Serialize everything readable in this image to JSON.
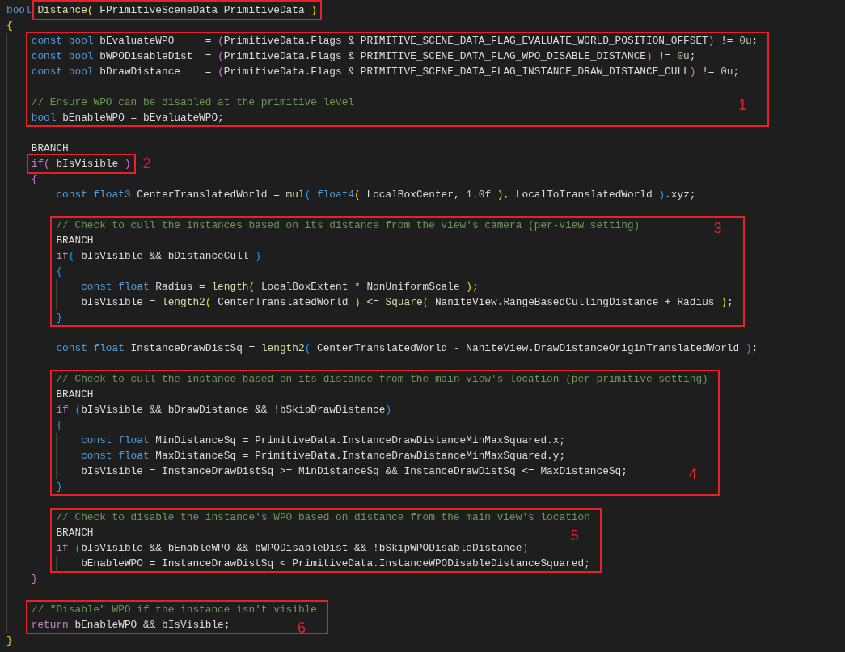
{
  "editor": {
    "items": [
      {
        "kind": "line",
        "tokens": [
          {
            "kind": "keyword",
            "text": "bool "
          },
          {
            "kind": "boxed",
            "tokens": [
              {
                "kind": "function",
                "text": "Distance"
              },
              {
                "kind": "bracket1",
                "text": "("
              },
              {
                "kind": "plain",
                "text": " FPrimitiveSceneData PrimitiveData "
              },
              {
                "kind": "bracket1",
                "text": ")"
              }
            ]
          }
        ]
      },
      {
        "kind": "line",
        "tokens": [
          {
            "kind": "bracket1",
            "text": "{"
          }
        ]
      },
      {
        "kind": "block",
        "children": [
          {
            "kind": "box",
            "children": [
              {
                "kind": "line",
                "tokens": [
                  {
                    "kind": "keyword",
                    "text": "const bool "
                  },
                  {
                    "kind": "plain",
                    "text": "bEvaluateWPO     = "
                  },
                  {
                    "kind": "bracket2",
                    "text": "("
                  },
                  {
                    "kind": "plain",
                    "text": "PrimitiveData.Flags & PRIMITIVE_SCENE_DATA_FLAG_EVALUATE_WORLD_POSITION_OFFSET"
                  },
                  {
                    "kind": "bracket2",
                    "text": ")"
                  },
                  {
                    "kind": "plain",
                    "text": " != "
                  },
                  {
                    "kind": "number",
                    "text": "0u"
                  },
                  {
                    "kind": "plain",
                    "text": ";"
                  }
                ]
              },
              {
                "kind": "line",
                "tokens": [
                  {
                    "kind": "keyword",
                    "text": "const bool "
                  },
                  {
                    "kind": "plain",
                    "text": "bWPODisableDist  = "
                  },
                  {
                    "kind": "bracket2",
                    "text": "("
                  },
                  {
                    "kind": "plain",
                    "text": "PrimitiveData.Flags & PRIMITIVE_SCENE_DATA_FLAG_WPO_DISABLE_DISTANCE"
                  },
                  {
                    "kind": "bracket2",
                    "text": ")"
                  },
                  {
                    "kind": "plain",
                    "text": " != "
                  },
                  {
                    "kind": "number",
                    "text": "0u"
                  },
                  {
                    "kind": "plain",
                    "text": ";"
                  }
                ]
              },
              {
                "kind": "line",
                "tokens": [
                  {
                    "kind": "keyword",
                    "text": "const bool "
                  },
                  {
                    "kind": "plain",
                    "text": "bDrawDistance    = "
                  },
                  {
                    "kind": "bracket2",
                    "text": "("
                  },
                  {
                    "kind": "plain",
                    "text": "PrimitiveData.Flags & PRIMITIVE_SCENE_DATA_FLAG_INSTANCE_DRAW_DISTANCE_CULL"
                  },
                  {
                    "kind": "bracket2",
                    "text": ")"
                  },
                  {
                    "kind": "plain",
                    "text": " != "
                  },
                  {
                    "kind": "number",
                    "text": "0u"
                  },
                  {
                    "kind": "plain",
                    "text": ";"
                  }
                ]
              },
              {
                "kind": "blank"
              },
              {
                "kind": "line",
                "note": "1",
                "tokens": [
                  {
                    "kind": "comment",
                    "text": "// Ensure WPO can be disabled at the primitive level"
                  }
                ]
              },
              {
                "kind": "line",
                "tokens": [
                  {
                    "kind": "keyword",
                    "text": "bool "
                  },
                  {
                    "kind": "plain",
                    "text": "bEnableWPO = bEvaluateWPO;"
                  }
                ]
              }
            ]
          },
          {
            "kind": "blank"
          },
          {
            "kind": "line",
            "tokens": [
              {
                "kind": "plain",
                "text": "BRANCH"
              }
            ]
          },
          {
            "kind": "line",
            "note": "2",
            "tokens": [
              {
                "kind": "boxed",
                "tokens": [
                  {
                    "kind": "control",
                    "text": "if"
                  },
                  {
                    "kind": "bracket2",
                    "text": "("
                  },
                  {
                    "kind": "plain",
                    "text": " bIsVisible "
                  },
                  {
                    "kind": "bracket2",
                    "text": ")"
                  }
                ]
              }
            ]
          },
          {
            "kind": "line",
            "tokens": [
              {
                "kind": "bracket2",
                "text": "{"
              }
            ]
          },
          {
            "kind": "block",
            "children": [
              {
                "kind": "line",
                "tokens": [
                  {
                    "kind": "keyword",
                    "text": "const float3 "
                  },
                  {
                    "kind": "plain",
                    "text": "CenterTranslatedWorld = "
                  },
                  {
                    "kind": "function",
                    "text": "mul"
                  },
                  {
                    "kind": "bracket3",
                    "text": "("
                  },
                  {
                    "kind": "keyword",
                    "text": " float4"
                  },
                  {
                    "kind": "bracket1",
                    "text": "("
                  },
                  {
                    "kind": "plain",
                    "text": " LocalBoxCenter, "
                  },
                  {
                    "kind": "number",
                    "text": "1.0f"
                  },
                  {
                    "kind": "bracket1",
                    "text": " )"
                  },
                  {
                    "kind": "plain",
                    "text": ", LocalToTranslatedWorld "
                  },
                  {
                    "kind": "bracket3",
                    "text": ")"
                  },
                  {
                    "kind": "plain",
                    "text": ".xyz;"
                  }
                ]
              },
              {
                "kind": "blank"
              },
              {
                "kind": "box",
                "children": [
                  {
                    "kind": "line",
                    "note": "3",
                    "tokens": [
                      {
                        "kind": "comment",
                        "text": "// Check to cull the instances based on its distance from the view's camera (per-view setting)"
                      }
                    ]
                  },
                  {
                    "kind": "line",
                    "tokens": [
                      {
                        "kind": "plain",
                        "text": "BRANCH"
                      }
                    ]
                  },
                  {
                    "kind": "line",
                    "tokens": [
                      {
                        "kind": "control",
                        "text": "if"
                      },
                      {
                        "kind": "bracket3",
                        "text": "("
                      },
                      {
                        "kind": "plain",
                        "text": " bIsVisible && bDistanceCull "
                      },
                      {
                        "kind": "bracket3",
                        "text": ")"
                      }
                    ]
                  },
                  {
                    "kind": "line",
                    "tokens": [
                      {
                        "kind": "bracket3",
                        "text": "{"
                      }
                    ]
                  },
                  {
                    "kind": "block",
                    "children": [
                      {
                        "kind": "line",
                        "tokens": [
                          {
                            "kind": "keyword",
                            "text": "const float "
                          },
                          {
                            "kind": "plain",
                            "text": "Radius = "
                          },
                          {
                            "kind": "function",
                            "text": "length"
                          },
                          {
                            "kind": "bracket1",
                            "text": "("
                          },
                          {
                            "kind": "plain",
                            "text": " LocalBoxExtent * NonUniformScale "
                          },
                          {
                            "kind": "bracket1",
                            "text": ")"
                          },
                          {
                            "kind": "plain",
                            "text": ";"
                          }
                        ]
                      },
                      {
                        "kind": "line",
                        "tokens": [
                          {
                            "kind": "plain",
                            "text": "bIsVisible = "
                          },
                          {
                            "kind": "function",
                            "text": "length2"
                          },
                          {
                            "kind": "bracket1",
                            "text": "("
                          },
                          {
                            "kind": "plain",
                            "text": " CenterTranslatedWorld "
                          },
                          {
                            "kind": "bracket1",
                            "text": ")"
                          },
                          {
                            "kind": "plain",
                            "text": " <= "
                          },
                          {
                            "kind": "function",
                            "text": "Square"
                          },
                          {
                            "kind": "bracket1",
                            "text": "("
                          },
                          {
                            "kind": "plain",
                            "text": " NaniteView.RangeBasedCullingDistance + Radius "
                          },
                          {
                            "kind": "bracket1",
                            "text": ")"
                          },
                          {
                            "kind": "plain",
                            "text": ";"
                          }
                        ]
                      }
                    ]
                  },
                  {
                    "kind": "line",
                    "tokens": [
                      {
                        "kind": "bracket3",
                        "text": "}"
                      }
                    ]
                  }
                ]
              },
              {
                "kind": "blank"
              },
              {
                "kind": "line",
                "tokens": [
                  {
                    "kind": "keyword",
                    "text": "const float "
                  },
                  {
                    "kind": "plain",
                    "text": "InstanceDrawDistSq = "
                  },
                  {
                    "kind": "function",
                    "text": "length2"
                  },
                  {
                    "kind": "bracket3",
                    "text": "("
                  },
                  {
                    "kind": "plain",
                    "text": " CenterTranslatedWorld - NaniteView.DrawDistanceOriginTranslatedWorld "
                  },
                  {
                    "kind": "bracket3",
                    "text": ")"
                  },
                  {
                    "kind": "plain",
                    "text": ";"
                  }
                ]
              },
              {
                "kind": "blank"
              },
              {
                "kind": "box",
                "children": [
                  {
                    "kind": "line",
                    "tokens": [
                      {
                        "kind": "comment",
                        "text": "// Check to cull the instance based on its distance from the main view's location (per-primitive setting)"
                      }
                    ]
                  },
                  {
                    "kind": "line",
                    "tokens": [
                      {
                        "kind": "plain",
                        "text": "BRANCH"
                      }
                    ]
                  },
                  {
                    "kind": "line",
                    "tokens": [
                      {
                        "kind": "control",
                        "text": "if "
                      },
                      {
                        "kind": "bracket3",
                        "text": "("
                      },
                      {
                        "kind": "plain",
                        "text": "bIsVisible && bDrawDistance && !bSkipDrawDistance"
                      },
                      {
                        "kind": "bracket3",
                        "text": ")"
                      }
                    ]
                  },
                  {
                    "kind": "line",
                    "tokens": [
                      {
                        "kind": "bracket3",
                        "text": "{"
                      }
                    ]
                  },
                  {
                    "kind": "block",
                    "children": [
                      {
                        "kind": "line",
                        "tokens": [
                          {
                            "kind": "keyword",
                            "text": "const float "
                          },
                          {
                            "kind": "plain",
                            "text": "MinDistanceSq = PrimitiveData.InstanceDrawDistanceMinMaxSquared.x;"
                          }
                        ]
                      },
                      {
                        "kind": "line",
                        "tokens": [
                          {
                            "kind": "keyword",
                            "text": "const float "
                          },
                          {
                            "kind": "plain",
                            "text": "MaxDistanceSq = PrimitiveData.InstanceDrawDistanceMinMaxSquared.y;"
                          }
                        ]
                      },
                      {
                        "kind": "line",
                        "note": "4",
                        "tokens": [
                          {
                            "kind": "plain",
                            "text": "bIsVisible = InstanceDrawDistSq >= MinDistanceSq && InstanceDrawDistSq <= MaxDistanceSq;"
                          }
                        ]
                      }
                    ]
                  },
                  {
                    "kind": "line",
                    "tokens": [
                      {
                        "kind": "bracket3",
                        "text": "}"
                      }
                    ]
                  }
                ]
              },
              {
                "kind": "blank"
              },
              {
                "kind": "box",
                "children": [
                  {
                    "kind": "line",
                    "tokens": [
                      {
                        "kind": "comment",
                        "text": "// Check to disable the instance's WPO based on distance from the main view's location"
                      }
                    ]
                  },
                  {
                    "kind": "line",
                    "note": "5",
                    "tokens": [
                      {
                        "kind": "plain",
                        "text": "BRANCH"
                      }
                    ]
                  },
                  {
                    "kind": "line",
                    "tokens": [
                      {
                        "kind": "control",
                        "text": "if "
                      },
                      {
                        "kind": "bracket3",
                        "text": "("
                      },
                      {
                        "kind": "plain",
                        "text": "bIsVisible && bEnableWPO && bWPODisableDist && !bSkipWPODisableDistance"
                      },
                      {
                        "kind": "bracket3",
                        "text": ")"
                      }
                    ]
                  },
                  {
                    "kind": "block",
                    "children": [
                      {
                        "kind": "line",
                        "tokens": [
                          {
                            "kind": "plain",
                            "text": "bEnableWPO = InstanceDrawDistSq < PrimitiveData.InstanceWPODisableDistanceSquared;"
                          }
                        ]
                      }
                    ]
                  }
                ]
              }
            ]
          },
          {
            "kind": "line",
            "tokens": [
              {
                "kind": "bracket2",
                "text": "}"
              }
            ]
          },
          {
            "kind": "blank"
          },
          {
            "kind": "box",
            "children": [
              {
                "kind": "line",
                "tokens": [
                  {
                    "kind": "comment",
                    "text": "// \"Disable\" WPO if the instance isn't visible"
                  }
                ]
              },
              {
                "kind": "line",
                "note": "6",
                "tokens": [
                  {
                    "kind": "control",
                    "text": "return "
                  },
                  {
                    "kind": "plain",
                    "text": "bEnableWPO && bIsVisible;"
                  }
                ]
              }
            ]
          }
        ]
      },
      {
        "kind": "line",
        "tokens": [
          {
            "kind": "bracket1",
            "text": "}"
          }
        ]
      }
    ]
  }
}
